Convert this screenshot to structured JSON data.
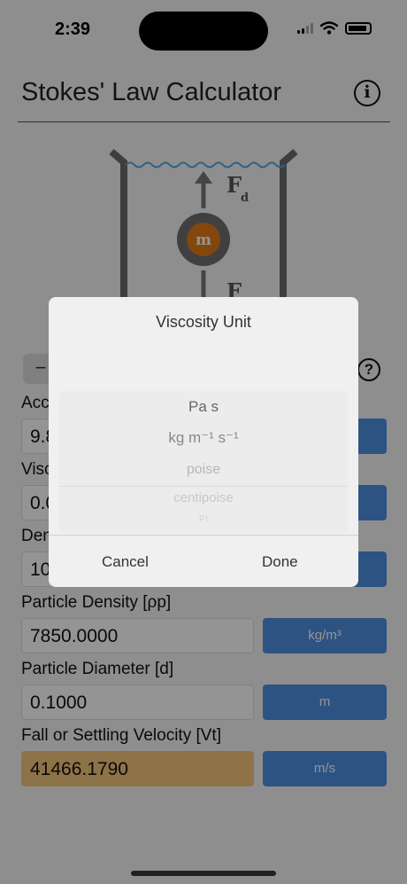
{
  "status": {
    "time": "2:39"
  },
  "header": {
    "title": "Stokes' Law Calculator",
    "info_label": "i"
  },
  "diagram": {
    "drag_force": "F",
    "drag_sub": "d",
    "gravity_force": "F",
    "mass": "m"
  },
  "controls": {
    "minus_label": "−",
    "help_label": "?"
  },
  "fields": [
    {
      "label": "Acc",
      "value": "9.8",
      "unit": ""
    },
    {
      "label": "Visc",
      "value": "0.0",
      "unit": ""
    },
    {
      "label": "Den",
      "value": "10",
      "unit": ""
    },
    {
      "label": "Particle Density [ρp]",
      "value": "7850.0000",
      "unit": "kg/m³"
    },
    {
      "label": "Particle Diameter [d]",
      "value": "0.1000",
      "unit": "m"
    },
    {
      "label": "Fall or Settling Velocity [Vt]",
      "value": "41466.1790",
      "unit": "m/s"
    }
  ],
  "dialog": {
    "title": "Viscosity Unit",
    "options": [
      "Pa s",
      "kg m⁻¹ s⁻¹",
      "poise",
      "centipoise",
      "PI"
    ],
    "cancel_label": "Cancel",
    "done_label": "Done"
  },
  "colors": {
    "unit_button": "#4e8fe2",
    "result_field": "#f5c57c",
    "particle": "#e47b14"
  }
}
